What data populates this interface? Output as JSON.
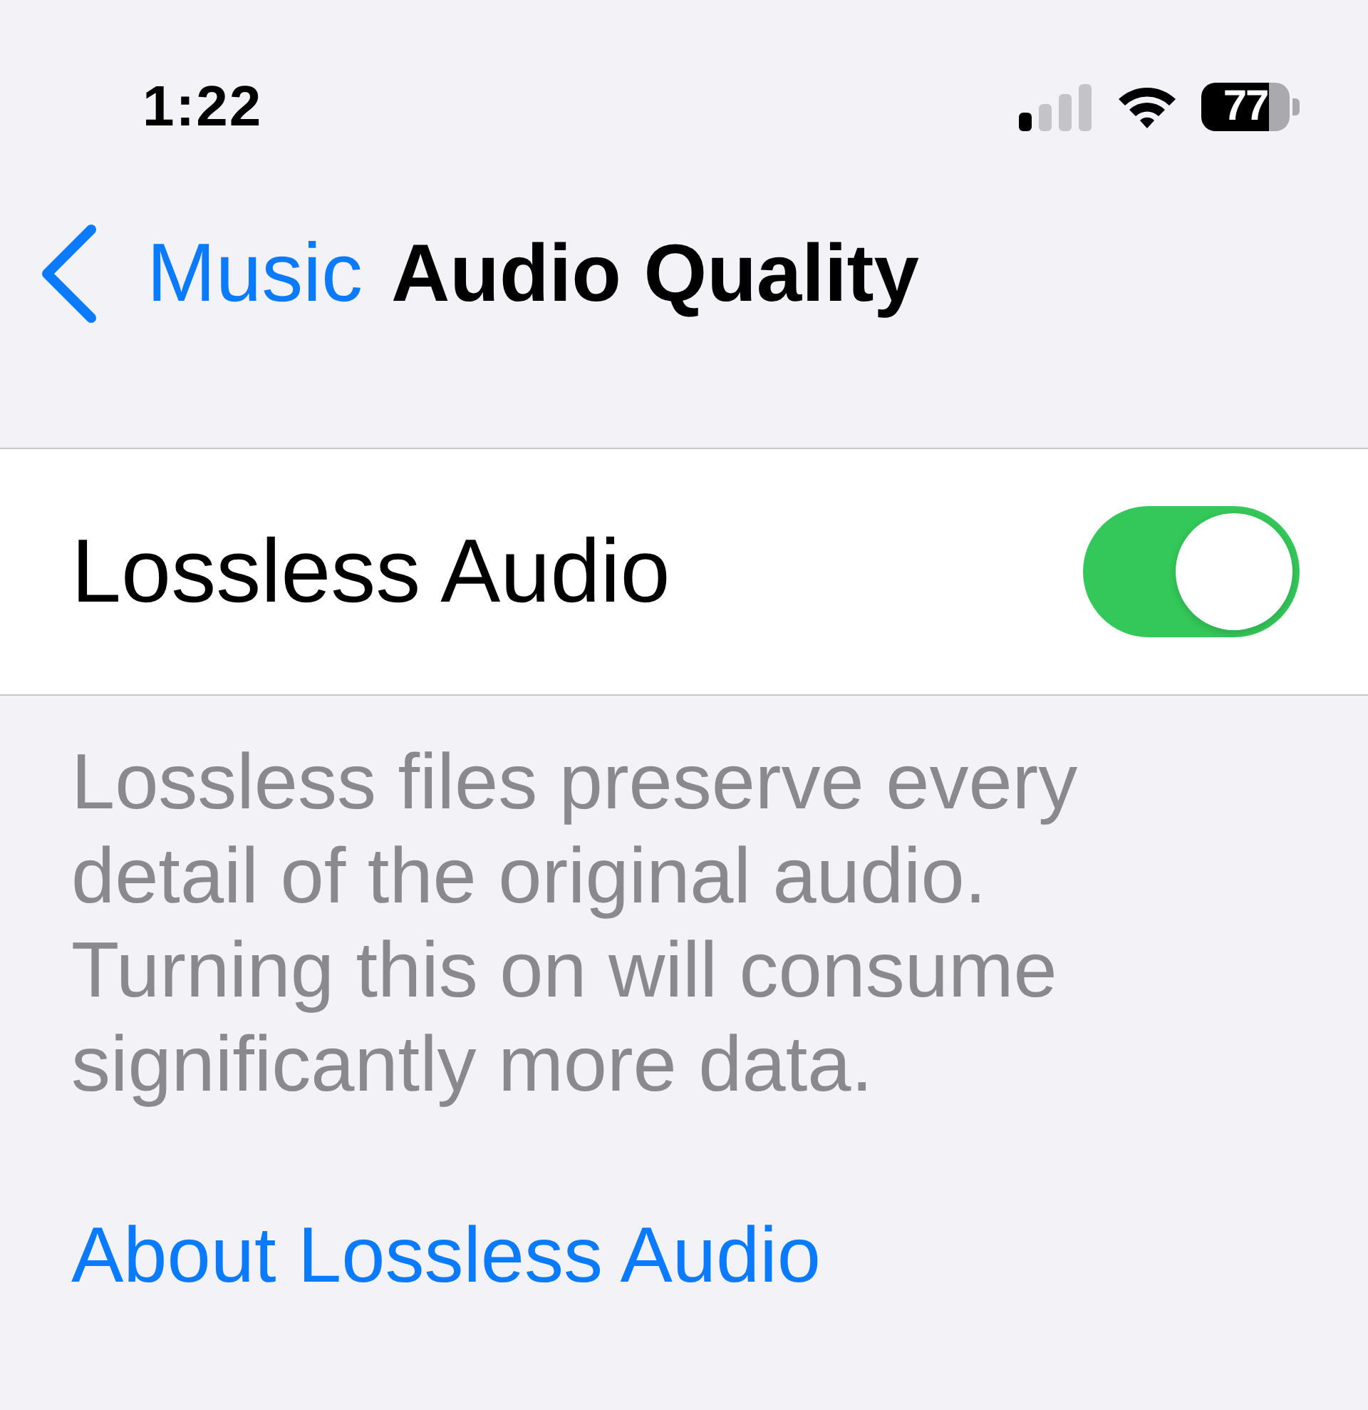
{
  "status_bar": {
    "time": "1:22",
    "battery": "77"
  },
  "nav": {
    "back_label": "Music",
    "title": "Audio Quality"
  },
  "settings": [
    {
      "kind": "toggle",
      "label": "Lossless Audio",
      "on": true
    }
  ],
  "footer": {
    "description": "Lossless files preserve every detail of the original audio. Turning this on will consume significantly more data.",
    "link": "About Lossless Audio"
  }
}
